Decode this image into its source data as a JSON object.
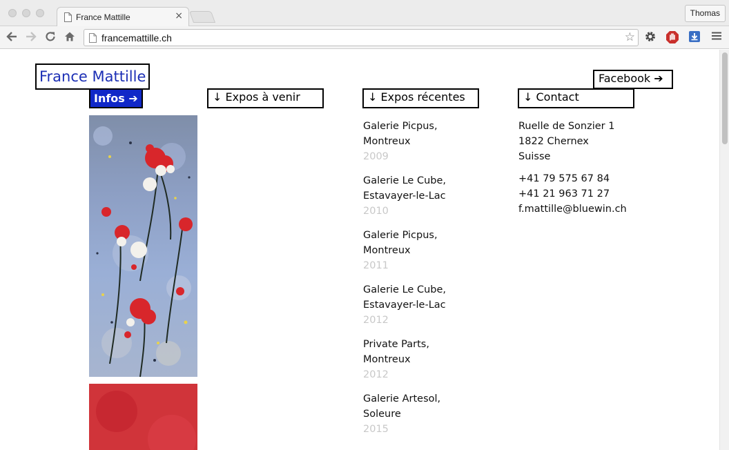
{
  "browser": {
    "tab_title": "France Mattille",
    "tab_close_glyph": "×",
    "profile_name": "Thomas",
    "url": "francemattille.ch",
    "icons": {
      "back": "arrow-left-icon",
      "forward": "arrow-right-icon",
      "reload": "reload-icon",
      "home": "home-icon",
      "bookmark": "star-icon",
      "settings": "gear-icon",
      "adblock": "stop-hand-icon",
      "download": "download-icon",
      "menu": "hamburger-menu-icon"
    },
    "colors": {
      "adblock": "#c9302c",
      "download": "#3a6fc4"
    }
  },
  "site": {
    "title": "France Mattille",
    "facebook_label": "Facebook ➔",
    "nav": {
      "infos": "Infos ➔",
      "upcoming": "↓ Expos à venir",
      "recent": "↓ Expos récentes",
      "contact": "↓ Contact"
    },
    "colors": {
      "title": "#1c2fb5",
      "infos_bg": "#1028c8",
      "year": "#c8c8c8"
    },
    "recent_exhibitions": [
      {
        "venue": "Galerie Picpus,",
        "city": "Montreux",
        "year": "2009"
      },
      {
        "venue": "Galerie Le Cube,",
        "city": "Estavayer-le-Lac",
        "year": "2010"
      },
      {
        "venue": "Galerie Picpus,",
        "city": "Montreux",
        "year": "2011"
      },
      {
        "venue": "Galerie Le Cube,",
        "city": "Estavayer-le-Lac",
        "year": "2012"
      },
      {
        "venue": "Private Parts,",
        "city": "Montreux",
        "year": "2012"
      },
      {
        "venue": "Galerie Artesol,",
        "city": "Soleure",
        "year": "2015"
      }
    ],
    "contact": {
      "address": [
        "Ruelle de Sonzier 1",
        "1822 Chernex",
        "Suisse"
      ],
      "phones": [
        "+41 79 575 67 84",
        "+41 21 963 71 27"
      ],
      "email": "f.mattille@bluewin.ch"
    }
  }
}
